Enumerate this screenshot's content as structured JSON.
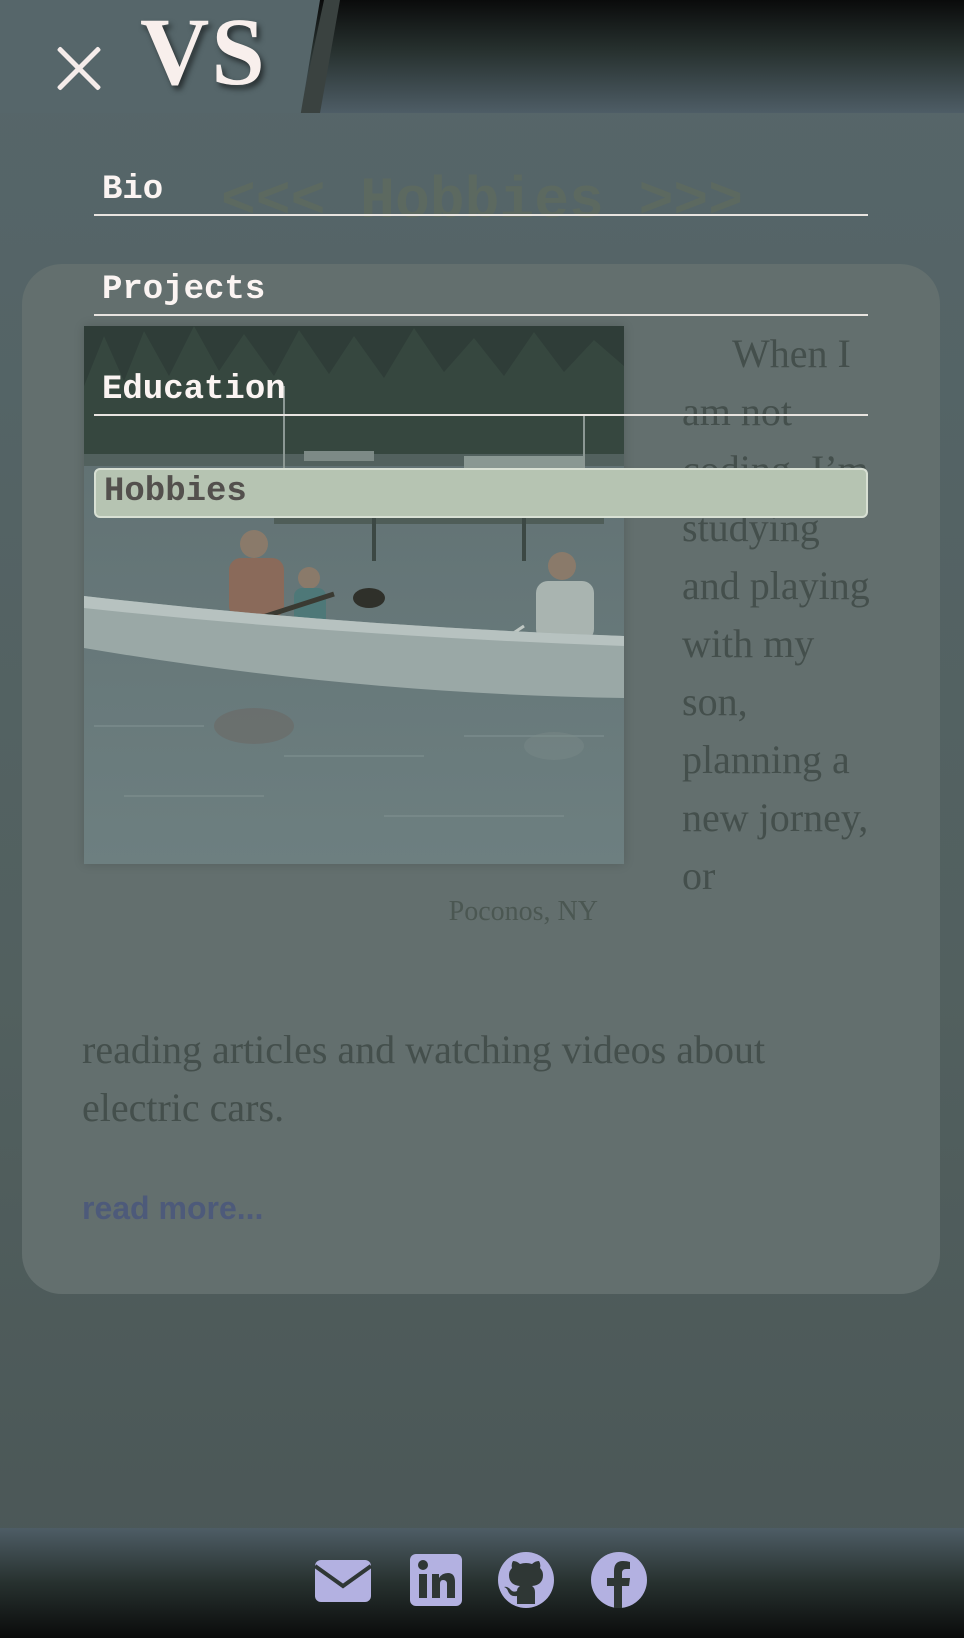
{
  "header": {
    "logo_text": "VS",
    "close_icon": "close-icon"
  },
  "section": {
    "title": "<<< Hobbies >>>"
  },
  "menu": {
    "items": [
      {
        "label": "Bio",
        "active": false
      },
      {
        "label": "Projects",
        "active": false
      },
      {
        "label": "Education",
        "active": false
      },
      {
        "label": "Hobbies",
        "active": true
      }
    ]
  },
  "content": {
    "photo_caption": "Poconos, NY",
    "paragraph_side": "When I am not coding, I’m studying and playing with my son, planning a new jorney, or",
    "paragraph_bottom": "reading articles and watching videos about electric cars.",
    "read_more": "read more..."
  },
  "footer": {
    "icons": [
      "mail-icon",
      "linkedin-icon",
      "github-icon",
      "facebook-icon"
    ]
  },
  "colors": {
    "accent_icon": "#b3b1e1",
    "menu_active_bg": "#b6c4b2",
    "card_bg": "#636f6e"
  }
}
